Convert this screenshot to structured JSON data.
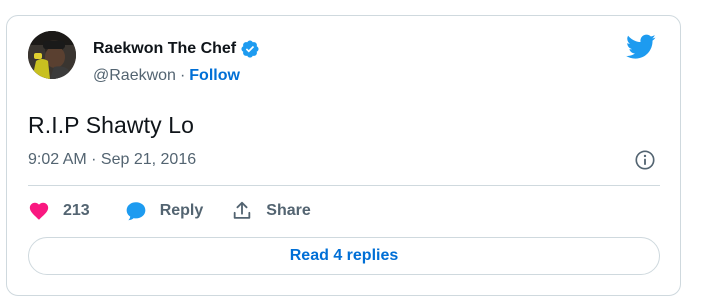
{
  "author": {
    "display_name": "Raekwon The Chef",
    "handle": "@Raekwon",
    "separator": "·",
    "follow_label": "Follow"
  },
  "tweet": {
    "text": "R.I.P Shawty Lo",
    "timestamp": "9:02 AM · Sep 21, 2016"
  },
  "actions": {
    "likes": "213",
    "reply_label": "Reply",
    "share_label": "Share"
  },
  "read_replies_label": "Read 4 replies",
  "colors": {
    "accent": "#006fd6",
    "twitter_blue": "#1d9bf0",
    "like_pink": "#f91880",
    "text": "#0f1419",
    "muted": "#536471",
    "border": "#cfd9de"
  },
  "icons": {
    "brand": "twitter-bird-icon",
    "verified": "verified-badge-icon",
    "info": "info-icon",
    "like": "heart-icon",
    "reply": "speech-bubble-icon",
    "share": "share-icon"
  }
}
